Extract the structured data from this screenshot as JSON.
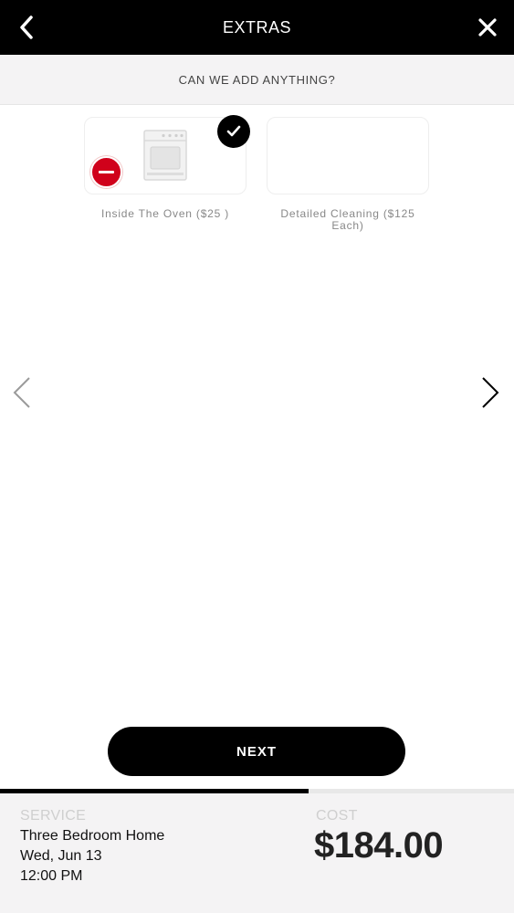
{
  "header": {
    "title": "EXTRAS",
    "back_icon": "chevron-left-icon",
    "close_icon": "close-icon"
  },
  "subheader": {
    "prompt": "CAN WE ADD ANYTHING?"
  },
  "extras": [
    {
      "label": "Inside The Oven ($25 )",
      "selected": true,
      "icon": "oven-icon"
    },
    {
      "label": "Detailed Cleaning ($125 Each)",
      "selected": false
    }
  ],
  "nav": {
    "prev_icon": "chevron-left-icon",
    "next_icon": "chevron-right-icon"
  },
  "actions": {
    "next_label": "NEXT"
  },
  "progress": {
    "fraction": 0.6
  },
  "summary": {
    "service_label": "SERVICE",
    "service_name": "Three Bedroom Home",
    "date": "Wed, Jun 13",
    "time": "12:00 PM",
    "cost_label": "COST",
    "cost_value": "$184.00"
  },
  "colors": {
    "header_bg": "#000000",
    "accent": "#000000",
    "remove": "#d0011b",
    "panel_bg": "#f4f3f4"
  }
}
